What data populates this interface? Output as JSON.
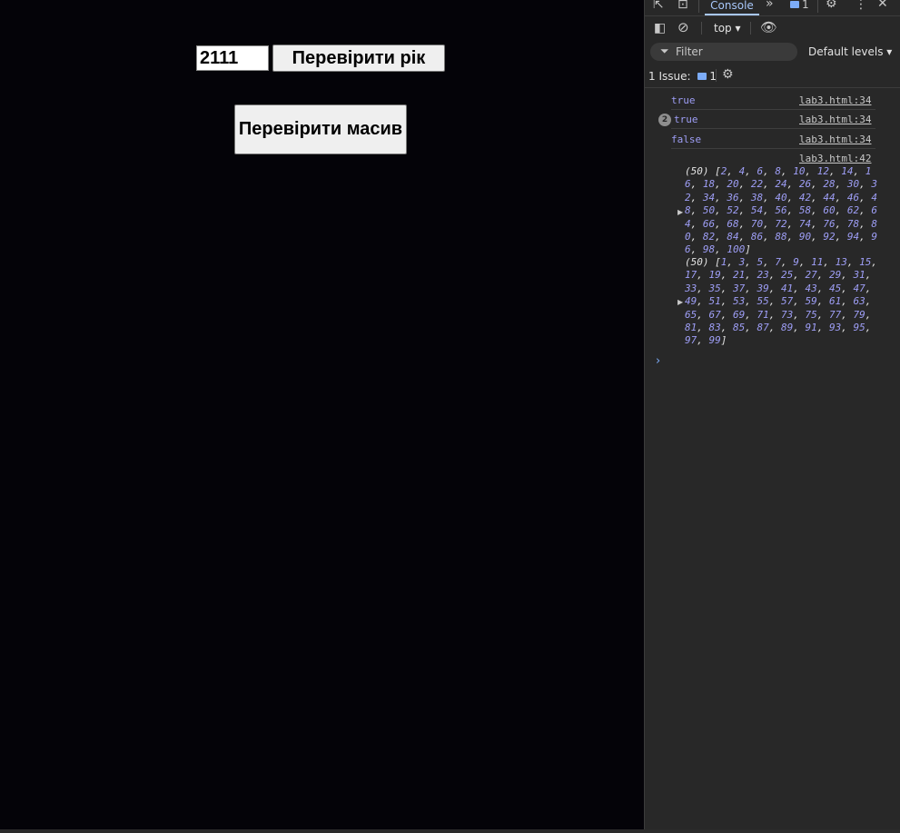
{
  "page": {
    "year_value": "2111",
    "check_year_label": "Перевірити рік",
    "check_array_label": "Перевірити масив"
  },
  "devtools": {
    "tabs": {
      "console_label": "Console",
      "issues_badge": "1"
    },
    "toolbar": {
      "context": "top ▾"
    },
    "filter": {
      "placeholder": "Filter",
      "levels_label": "Default levels ▾"
    },
    "issues": {
      "label": "1 Issue:",
      "count": "1"
    },
    "messages": [
      {
        "text": "true",
        "source": "lab3.html:34"
      },
      {
        "text": "true",
        "source": "lab3.html:34",
        "repeat": "2"
      },
      {
        "text": "false",
        "source": "lab3.html:34"
      }
    ],
    "arrays_source": "lab3.html:42",
    "even_array": {
      "prefix": "(50) [",
      "values": [
        2,
        4,
        6,
        8,
        10,
        12,
        14,
        16,
        18,
        20,
        22,
        24,
        26,
        28,
        30,
        32,
        34,
        36,
        38,
        40,
        42,
        44,
        46,
        48,
        50,
        52,
        54,
        56,
        58,
        60,
        62,
        64,
        66,
        68,
        70,
        72,
        74,
        76,
        78,
        80,
        82,
        84,
        86,
        88,
        90,
        92,
        94,
        96,
        98,
        100
      ]
    },
    "odd_array": {
      "prefix": "(50) [",
      "values": [
        1,
        3,
        5,
        7,
        9,
        11,
        13,
        15,
        17,
        19,
        21,
        23,
        25,
        27,
        29,
        31,
        33,
        35,
        37,
        39,
        41,
        43,
        45,
        47,
        49,
        51,
        53,
        55,
        57,
        59,
        61,
        63,
        65,
        67,
        69,
        71,
        73,
        75,
        77,
        79,
        81,
        83,
        85,
        87,
        89,
        91,
        93,
        95,
        97,
        99
      ]
    },
    "colors": {
      "value": "#9e9ef6",
      "link": "#c7c7c7",
      "accent": "#a8c7fa"
    }
  }
}
